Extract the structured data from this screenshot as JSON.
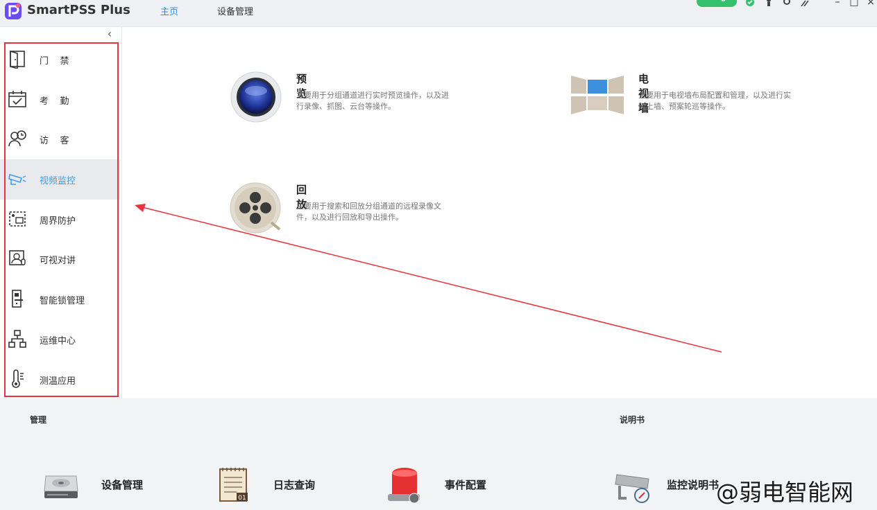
{
  "app": {
    "name": "SmartPSS Plus"
  },
  "nav": {
    "tabs": [
      {
        "label": "主页",
        "active": true
      },
      {
        "label": "设备管理",
        "active": false
      }
    ]
  },
  "status": {
    "count": "0"
  },
  "sidebar": {
    "items": [
      {
        "label": "门    禁",
        "icon": "door-icon"
      },
      {
        "label": "考    勤",
        "icon": "calendar-check-icon"
      },
      {
        "label": "访    客",
        "icon": "visitor-icon"
      },
      {
        "label": "视频监控",
        "icon": "camera-icon",
        "active": true
      },
      {
        "label": "周界防护",
        "icon": "perimeter-icon"
      },
      {
        "label": "可视对讲",
        "icon": "intercom-icon"
      },
      {
        "label": "智能锁管理",
        "icon": "smart-lock-icon"
      },
      {
        "label": "运维中心",
        "icon": "network-tree-icon"
      },
      {
        "label": "测温应用",
        "icon": "thermometer-icon"
      }
    ]
  },
  "apps": [
    {
      "title": "预览",
      "desc": "主要用于分组通道进行实时预览操作，以及进行录像、抓图、云台等操作。",
      "icon": "preview-lens-icon"
    },
    {
      "title": "电视墙",
      "desc": "主要用于电视墙布局配置和管理，以及进行实时上墙、预案轮巡等操作。",
      "icon": "video-wall-icon"
    },
    {
      "title": "回放",
      "desc": "主要用于搜索和回放分组通道的远程录像文件，以及进行回放和导出操作。",
      "icon": "film-reel-icon"
    }
  ],
  "bottom": {
    "manage_title": "管理",
    "manual_title": "说明书",
    "tools": [
      {
        "label": "设备管理",
        "icon": "hard-drive-icon"
      },
      {
        "label": "日志查询",
        "icon": "log-notepad-icon"
      },
      {
        "label": "事件配置",
        "icon": "alarm-light-icon"
      },
      {
        "label": "监控说明书",
        "icon": "camera-manual-icon"
      }
    ]
  },
  "watermark": "@弱电智能网",
  "colors": {
    "accent": "#2d8cf0",
    "highlight_box": "#e8323c"
  }
}
